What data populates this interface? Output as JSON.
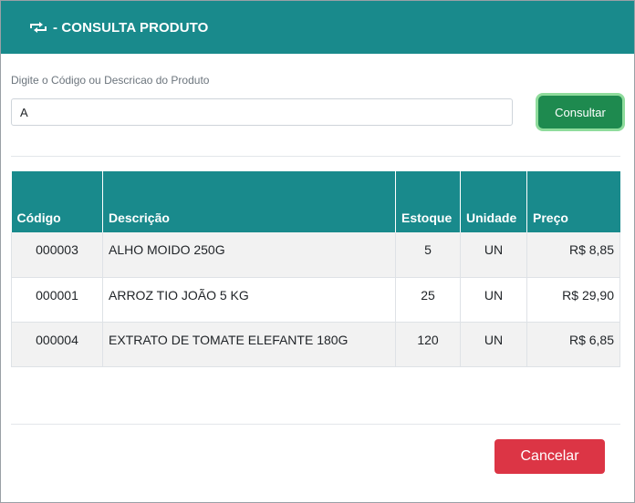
{
  "header": {
    "title": "- CONSULTA PRODUTO",
    "icon": "repeat-icon"
  },
  "search": {
    "label": "Digite o Código ou Descricao do Produto",
    "value": "A",
    "button_label": "Consultar"
  },
  "table": {
    "columns": [
      "Código",
      "Descrição",
      "Estoque",
      "Unidade",
      "Preço"
    ],
    "rows": [
      {
        "codigo": "000003",
        "descricao": "ALHO MOIDO 250G",
        "estoque": "5",
        "unidade": "UN",
        "preco": "R$ 8,85"
      },
      {
        "codigo": "000001",
        "descricao": "ARROZ TIO JOÃO 5 KG",
        "estoque": "25",
        "unidade": "UN",
        "preco": "R$ 29,90"
      },
      {
        "codigo": "000004",
        "descricao": "EXTRATO DE TOMATE ELEFANTE 180G",
        "estoque": "120",
        "unidade": "UN",
        "preco": "R$ 6,85"
      }
    ]
  },
  "footer": {
    "cancel_label": "Cancelar"
  },
  "colors": {
    "header_bg": "#198a8c",
    "primary_button": "#1e8a4f",
    "cancel_button": "#dc3545"
  }
}
